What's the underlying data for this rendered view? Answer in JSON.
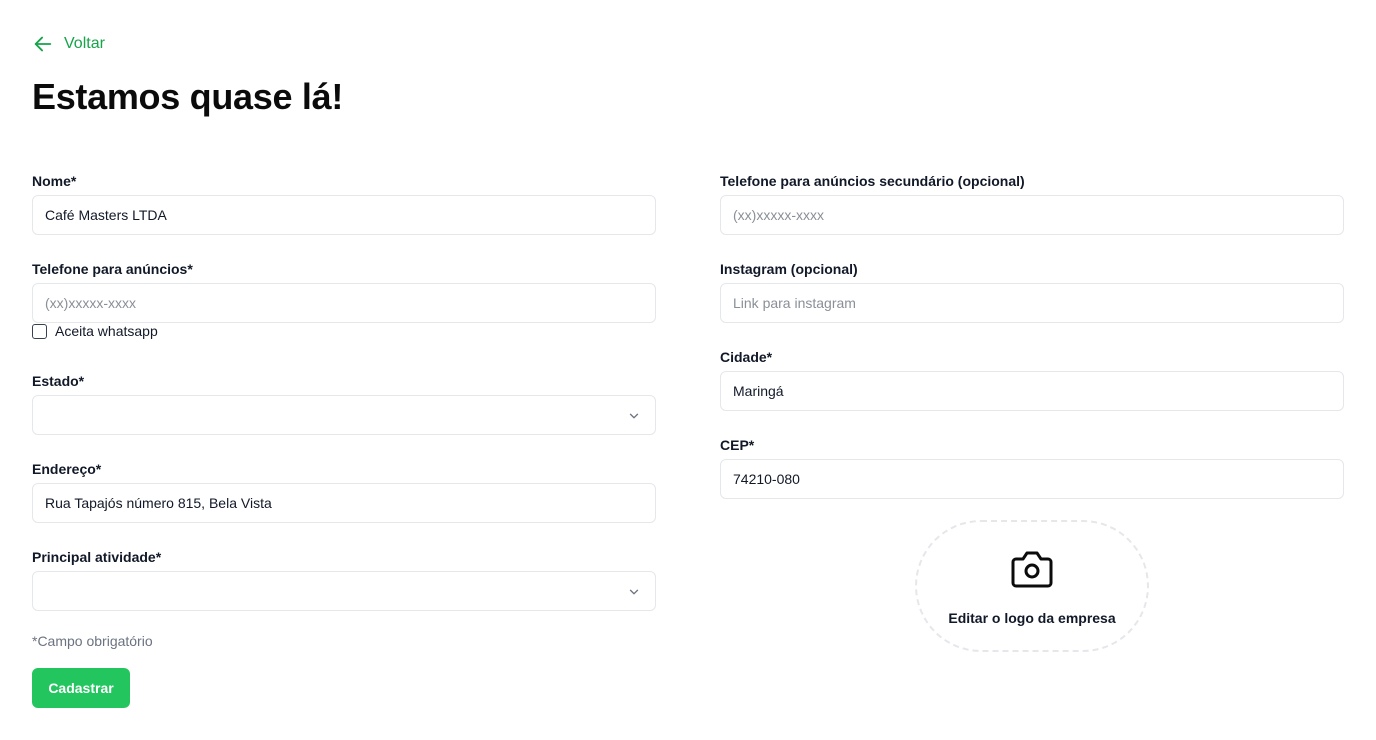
{
  "back": {
    "label": "Voltar"
  },
  "title": "Estamos quase lá!",
  "form": {
    "nome": {
      "label": "Nome*",
      "value": "Café Masters LTDA",
      "placeholder": ""
    },
    "telefone": {
      "label": "Telefone para anúncios*",
      "value": "",
      "placeholder": "(xx)xxxxx-xxxx"
    },
    "whatsapp": {
      "label": "Aceita whatsapp",
      "checked": false
    },
    "estado": {
      "label": "Estado*",
      "value": ""
    },
    "endereco": {
      "label": "Endereço*",
      "value": "Rua Tapajós número 815, Bela Vista",
      "placeholder": ""
    },
    "atividade": {
      "label": "Principal atividade*",
      "value": ""
    },
    "telefone_secundario": {
      "label": "Telefone para anúncios secundário (opcional)",
      "value": "",
      "placeholder": "(xx)xxxxx-xxxx"
    },
    "instagram": {
      "label": "Instagram (opcional)",
      "value": "",
      "placeholder": "Link para instagram"
    },
    "cidade": {
      "label": "Cidade*",
      "value": "Maringá",
      "placeholder": ""
    },
    "cep": {
      "label": "CEP*",
      "value": "74210-080",
      "placeholder": ""
    }
  },
  "required_note": "*Campo obrigatório",
  "submit_label": "Cadastrar",
  "logo_upload": {
    "label": "Editar o logo da empresa",
    "icon": "camera-icon"
  },
  "colors": {
    "accent": "#22c55e",
    "link": "#16a34a",
    "border": "#e5e7eb"
  }
}
